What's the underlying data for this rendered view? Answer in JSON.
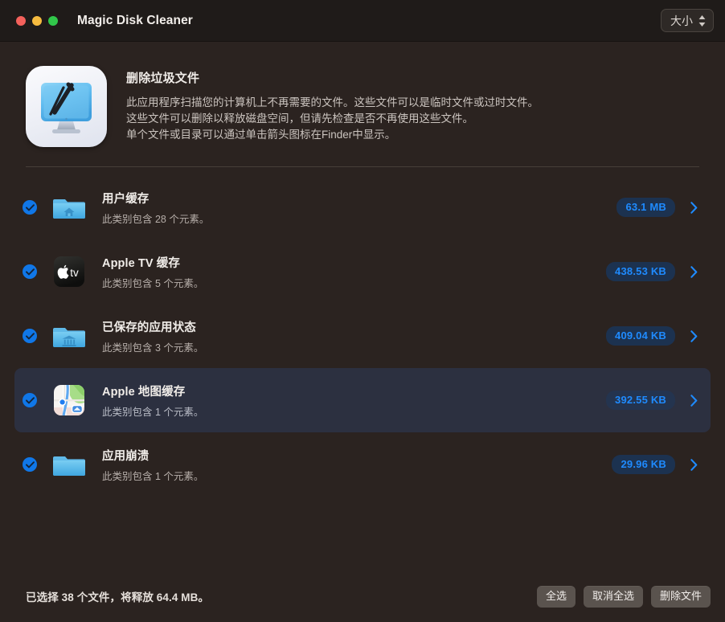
{
  "window": {
    "title": "Magic Disk Cleaner",
    "size_popup_label": "大小",
    "traffic_lights": [
      "close-button",
      "minimize-button",
      "zoom-button"
    ]
  },
  "intro": {
    "icon_name": "app-icon-disk-cleaner",
    "title": "删除垃圾文件",
    "desc_line1": "此应用程序扫描您的计算机上不再需要的文件。这些文件可以是临时文件或过时文件。",
    "desc_line2": "这些文件可以删除以释放磁盘空间，但请先检查是否不再使用这些文件。",
    "desc_line3": "单个文件或目录可以通过单击箭头图标在Finder中显示。"
  },
  "list": {
    "rows": [
      {
        "icon": "folder-home-icon",
        "title": "用户缓存",
        "subtitle": "此类别包含 28 个元素。",
        "size": "63.1 MB",
        "checked": true,
        "selected": false
      },
      {
        "icon": "apple-tv-icon",
        "title": "Apple TV 缓存",
        "subtitle": "此类别包含 5 个元素。",
        "size": "438.53 KB",
        "checked": true,
        "selected": false
      },
      {
        "icon": "folder-library-icon",
        "title": "已保存的应用状态",
        "subtitle": "此类别包含 3 个元素。",
        "size": "409.04 KB",
        "checked": true,
        "selected": false
      },
      {
        "icon": "apple-maps-icon",
        "title": "Apple 地图缓存",
        "subtitle": "此类别包含 1 个元素。",
        "size": "392.55 KB",
        "checked": true,
        "selected": true
      },
      {
        "icon": "folder-plain-icon",
        "title": "应用崩溃",
        "subtitle": "此类别包含 1 个元素。",
        "size": "29.96 KB",
        "checked": true,
        "selected": false
      }
    ]
  },
  "footer": {
    "status": "已选择 38 个文件，将释放 64.4 MB。",
    "select_all_label": "全选",
    "deselect_all_label": "取消全选",
    "delete_files_label": "删除文件"
  },
  "colors": {
    "window_background": "#2b2320",
    "titlebar_background": "#1f1b19",
    "selected_row": "#2c3040",
    "accent_blue": "#1f8bff",
    "badge_background": "#1c3250",
    "checkbox_blue": "#1077e8",
    "button_gray": "#5a534e"
  }
}
